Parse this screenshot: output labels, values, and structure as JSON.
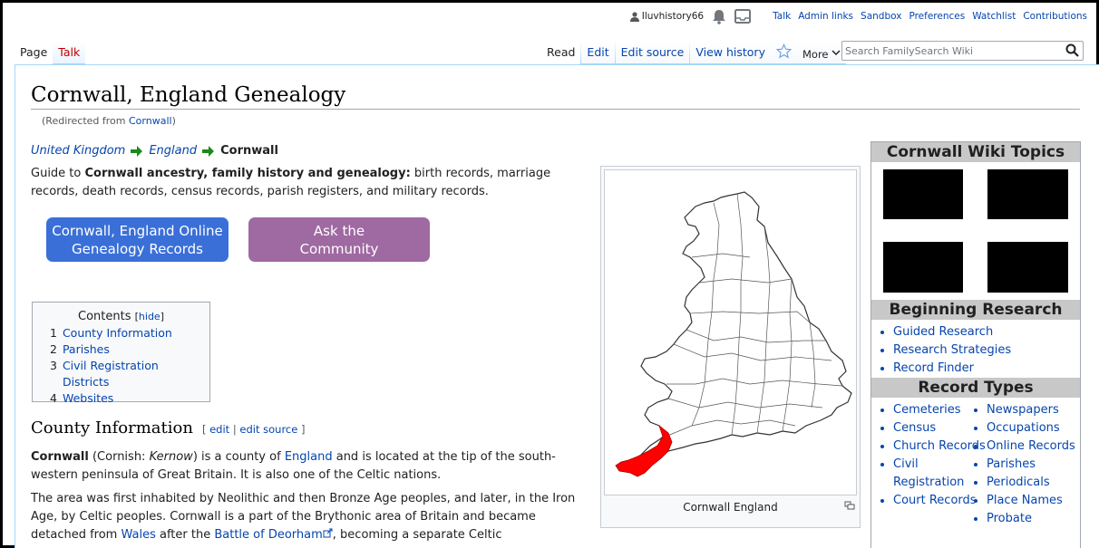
{
  "personal": {
    "username": "Iluvhistory66",
    "links": [
      "Talk",
      "Admin links",
      "Sandbox",
      "Preferences",
      "Watchlist",
      "Contributions"
    ]
  },
  "tabs": {
    "left": [
      "Page",
      "Talk"
    ],
    "right": [
      "Read",
      "Edit",
      "Edit source",
      "View history"
    ],
    "more": "More"
  },
  "search": {
    "placeholder": "Search FamilySearch Wiki"
  },
  "page": {
    "title": "Cornwall, England Genealogy",
    "redirected_prefix": "(Redirected from ",
    "redirected_link": "Cornwall",
    "redirected_suffix": ")"
  },
  "breadcrumb": [
    "United Kingdom",
    "England",
    "Cornwall"
  ],
  "intro": {
    "prefix": "Guide to ",
    "bold": "Cornwall ancestry, family history and genealogy:",
    "rest": " birth records, marriage records, death records, census records, parish registers, and military records."
  },
  "buttons": {
    "records": "Cornwall, England Online Genealogy Records",
    "community_line1": "Ask the",
    "community_line2": "Community"
  },
  "toc": {
    "title": "Contents",
    "hide": "hide",
    "items": [
      {
        "num": "1",
        "label": "County Information"
      },
      {
        "num": "2",
        "label": "Parishes"
      },
      {
        "num": "3",
        "label": "Civil Registration Districts"
      },
      {
        "num": "4",
        "label": "Websites"
      }
    ]
  },
  "section": {
    "heading": "County Information",
    "edit": "edit",
    "edit_source": "edit source"
  },
  "para1": {
    "bold": "Cornwall",
    "a": " (Cornish: ",
    "italic": "Kernow",
    "b": ") is a county of ",
    "link": "England",
    "c": " and is located at the tip of the south-western peninsula of Great Britain. It is also one of the Celtic nations."
  },
  "para2": {
    "a": "The area was first inhabited by Neolithic and then Bronze Age peoples, and later, in the Iron Age, by Celtic peoples. Cornwall is a part of the Brythonic area of Britain and became detached from ",
    "link1": "Wales",
    "b": " after the ",
    "link2": "Battle of Deorham",
    "c": ", becoming a separate Celtic"
  },
  "map": {
    "caption": "Cornwall England",
    "highlight_color": "#ff0000"
  },
  "infobox": {
    "title": "Cornwall Wiki Topics",
    "beginning_heading": "Beginning Research",
    "beginning_items": [
      "Guided Research",
      "Research Strategies",
      "Record Finder"
    ],
    "record_heading": "Record Types",
    "col1": [
      "Cemeteries",
      "Census",
      "Church Records",
      "Civil Registration",
      "Court Records"
    ],
    "col2": [
      "Newspapers",
      "Occupations",
      "Online Records",
      "Parishes",
      "Periodicals",
      "Place Names",
      "Probate"
    ]
  },
  "colors": {
    "link": "#0645ad",
    "button_blue": "#3a6fd8",
    "button_purple": "#9f69a2",
    "arrow_green": "#1a8a1a"
  }
}
